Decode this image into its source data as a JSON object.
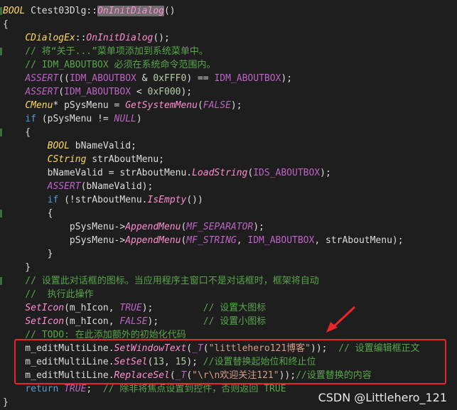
{
  "colors": {
    "background": "#1e1e1e",
    "plain": "#dcdcdc",
    "type": "#ffd75f",
    "function": "#ff8cd0",
    "macro": "#bd63c5",
    "comment": "#57a64a",
    "keyword": "#569cd6",
    "number": "#b5cea8",
    "string": "#d69d85",
    "annotation_red": "#e8252b"
  },
  "code_lines": [
    [
      {
        "t": "BOOL",
        "c": "type",
        "i": true
      },
      {
        "t": " Ctest03Dlg::",
        "c": "plain"
      },
      {
        "t": "OnInitDialog",
        "c": "fnhl",
        "i": true
      },
      {
        "t": "()",
        "c": "plain"
      }
    ],
    [
      {
        "t": "{",
        "c": "plain"
      }
    ],
    [
      {
        "t": "    ",
        "c": "plain"
      },
      {
        "t": "CDialogEx",
        "c": "type",
        "i": true
      },
      {
        "t": "::",
        "c": "plain"
      },
      {
        "t": "OnInitDialog",
        "c": "function",
        "i": true
      },
      {
        "t": "();",
        "c": "plain"
      }
    ],
    [
      {
        "t": "    // 将“关于...”菜单项添加到系统菜单中。",
        "c": "comment"
      }
    ],
    [
      {
        "t": "    // IDM_ABOUTBOX 必须在系统命令范围内。",
        "c": "comment"
      }
    ],
    [
      {
        "t": "    ",
        "c": "plain"
      },
      {
        "t": "ASSERT",
        "c": "macro",
        "i": true
      },
      {
        "t": "((",
        "c": "plain"
      },
      {
        "t": "IDM_ABOUTBOX",
        "c": "macro"
      },
      {
        "t": " & ",
        "c": "plain"
      },
      {
        "t": "0xFFF0",
        "c": "number"
      },
      {
        "t": ") == ",
        "c": "plain"
      },
      {
        "t": "IDM_ABOUTBOX",
        "c": "macro"
      },
      {
        "t": ");",
        "c": "plain"
      }
    ],
    [
      {
        "t": "    ",
        "c": "plain"
      },
      {
        "t": "ASSERT",
        "c": "macro",
        "i": true
      },
      {
        "t": "(",
        "c": "plain"
      },
      {
        "t": "IDM_ABOUTBOX",
        "c": "macro"
      },
      {
        "t": " < ",
        "c": "plain"
      },
      {
        "t": "0xF000",
        "c": "number"
      },
      {
        "t": ");",
        "c": "plain"
      }
    ],
    [
      {
        "t": "    ",
        "c": "plain"
      },
      {
        "t": "CMenu",
        "c": "type",
        "i": true
      },
      {
        "t": "* pSysMenu = ",
        "c": "plain"
      },
      {
        "t": "GetSystemMenu",
        "c": "function",
        "i": true
      },
      {
        "t": "(",
        "c": "plain"
      },
      {
        "t": "FALSE",
        "c": "macro",
        "i": true
      },
      {
        "t": ");",
        "c": "plain"
      }
    ],
    [
      {
        "t": "    ",
        "c": "plain"
      },
      {
        "t": "if",
        "c": "keyword"
      },
      {
        "t": " (pSysMenu != ",
        "c": "plain"
      },
      {
        "t": "NULL",
        "c": "macro",
        "i": true
      },
      {
        "t": ")",
        "c": "plain"
      }
    ],
    [
      {
        "t": "    {",
        "c": "plain"
      }
    ],
    [
      {
        "t": "        ",
        "c": "plain"
      },
      {
        "t": "BOOL",
        "c": "type",
        "i": true
      },
      {
        "t": " bNameValid;",
        "c": "plain"
      }
    ],
    [
      {
        "t": "        ",
        "c": "plain"
      },
      {
        "t": "CString",
        "c": "type",
        "i": true
      },
      {
        "t": " strAboutMenu;",
        "c": "plain"
      }
    ],
    [
      {
        "t": "        bNameValid = strAboutMenu.",
        "c": "plain"
      },
      {
        "t": "LoadString",
        "c": "function",
        "i": true
      },
      {
        "t": "(",
        "c": "plain"
      },
      {
        "t": "IDS_ABOUTBOX",
        "c": "macro"
      },
      {
        "t": ");",
        "c": "plain"
      }
    ],
    [
      {
        "t": "        ",
        "c": "plain"
      },
      {
        "t": "ASSERT",
        "c": "macro",
        "i": true
      },
      {
        "t": "(bNameValid);",
        "c": "plain"
      }
    ],
    [
      {
        "t": "        ",
        "c": "plain"
      },
      {
        "t": "if",
        "c": "keyword"
      },
      {
        "t": " (!strAboutMenu.",
        "c": "plain"
      },
      {
        "t": "IsEmpty",
        "c": "function",
        "i": true
      },
      {
        "t": "())",
        "c": "plain"
      }
    ],
    [
      {
        "t": "        {",
        "c": "plain"
      }
    ],
    [
      {
        "t": "            pSysMenu->",
        "c": "plain"
      },
      {
        "t": "AppendMenu",
        "c": "function",
        "i": true
      },
      {
        "t": "(",
        "c": "plain"
      },
      {
        "t": "MF_SEPARATOR",
        "c": "macro",
        "i": true
      },
      {
        "t": ");",
        "c": "plain"
      }
    ],
    [
      {
        "t": "            pSysMenu->",
        "c": "plain"
      },
      {
        "t": "AppendMenu",
        "c": "function",
        "i": true
      },
      {
        "t": "(",
        "c": "plain"
      },
      {
        "t": "MF_STRING",
        "c": "macro",
        "i": true
      },
      {
        "t": ", ",
        "c": "plain"
      },
      {
        "t": "IDM_ABOUTBOX",
        "c": "macro"
      },
      {
        "t": ", strAboutMenu);",
        "c": "plain"
      }
    ],
    [
      {
        "t": "        }",
        "c": "plain"
      }
    ],
    [
      {
        "t": "    }",
        "c": "plain"
      }
    ],
    [
      {
        "t": "    // 设置此对话框的图标。当应用程序主窗口不是对话框时，框架将自动",
        "c": "comment"
      }
    ],
    [
      {
        "t": "    //  执行此操作",
        "c": "comment"
      }
    ],
    [
      {
        "t": "    ",
        "c": "plain"
      },
      {
        "t": "SetIcon",
        "c": "function",
        "i": true
      },
      {
        "t": "(m_hIcon, ",
        "c": "plain"
      },
      {
        "t": "TRUE",
        "c": "macro",
        "i": true
      },
      {
        "t": ");         ",
        "c": "plain"
      },
      {
        "t": "// 设置大图标",
        "c": "comment"
      }
    ],
    [
      {
        "t": "    ",
        "c": "plain"
      },
      {
        "t": "SetIcon",
        "c": "function",
        "i": true
      },
      {
        "t": "(m_hIcon, ",
        "c": "plain"
      },
      {
        "t": "FALSE",
        "c": "macro",
        "i": true
      },
      {
        "t": ");        ",
        "c": "plain"
      },
      {
        "t": "// 设置小图标",
        "c": "comment"
      }
    ],
    [
      {
        "t": "    // TODO: 在此添加额外的初始化代码",
        "c": "comment"
      }
    ],
    [
      {
        "t": "    m_editMultiLine.",
        "c": "plain"
      },
      {
        "t": "SetWindowText",
        "c": "function",
        "i": true
      },
      {
        "t": "(",
        "c": "plain"
      },
      {
        "t": "_T",
        "c": "macro",
        "i": true
      },
      {
        "t": "(",
        "c": "plain"
      },
      {
        "t": "\"littlehero121博客\"",
        "c": "string"
      },
      {
        "t": "));  ",
        "c": "plain"
      },
      {
        "t": "// 设置编辑框正文",
        "c": "comment"
      }
    ],
    [
      {
        "t": "    m_editMultiLine.",
        "c": "plain"
      },
      {
        "t": "SetSel",
        "c": "function",
        "i": true
      },
      {
        "t": "(",
        "c": "plain"
      },
      {
        "t": "13",
        "c": "number"
      },
      {
        "t": ", ",
        "c": "plain"
      },
      {
        "t": "15",
        "c": "number"
      },
      {
        "t": "); ",
        "c": "plain"
      },
      {
        "t": "//设置替换起始位和终止位",
        "c": "comment"
      }
    ],
    [
      {
        "t": "    m_editMultiLine.",
        "c": "plain"
      },
      {
        "t": "ReplaceSel",
        "c": "function",
        "i": true
      },
      {
        "t": "(",
        "c": "plain"
      },
      {
        "t": "_T",
        "c": "macro",
        "i": true
      },
      {
        "t": "(",
        "c": "plain"
      },
      {
        "t": "\"\\r\\n欢迎关注121\"",
        "c": "string"
      },
      {
        "t": "));",
        "c": "plain"
      },
      {
        "t": "//设置替换的内容",
        "c": "comment"
      }
    ],
    [
      {
        "t": "    ",
        "c": "plain"
      },
      {
        "t": "return",
        "c": "keyword"
      },
      {
        "t": " ",
        "c": "plain"
      },
      {
        "t": "TRUE",
        "c": "macro",
        "i": true
      },
      {
        "t": ";  ",
        "c": "plain"
      },
      {
        "t": "// 除非将焦点设置到控件，否则返回 TRUE",
        "c": "comment"
      }
    ],
    [
      {
        "t": "}",
        "c": "plain"
      }
    ]
  ],
  "watermark": "CSDN @Littlehero_121"
}
